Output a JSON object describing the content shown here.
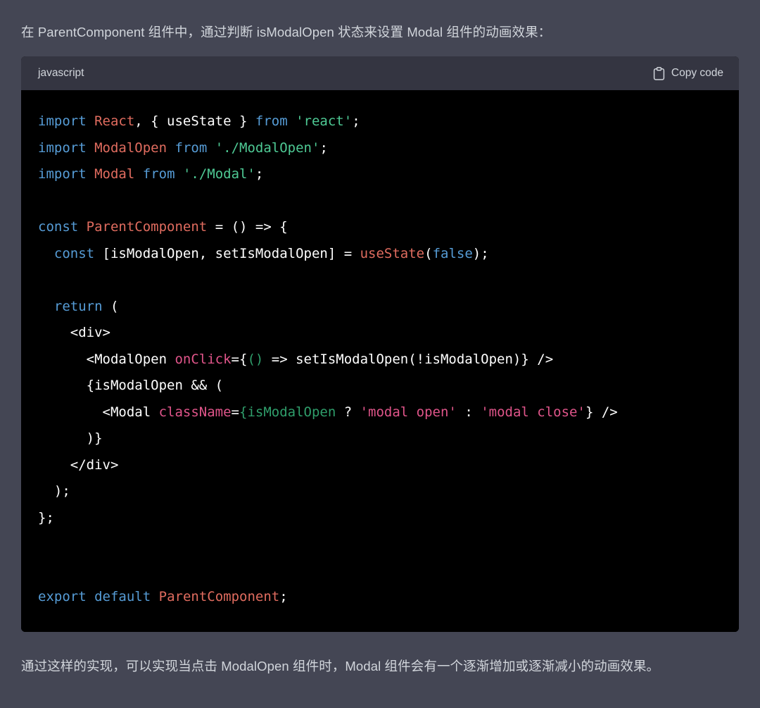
{
  "intro": {
    "text": "在 ParentComponent 组件中，通过判断 isModalOpen 状态来设置 Modal 组件的动画效果："
  },
  "outro": {
    "text": "通过这样的实现，可以实现当点击 ModalOpen 组件时，Modal 组件会有一个逐渐增加或逐渐减小的动画效果。"
  },
  "code_block": {
    "language_label": "javascript",
    "copy_label": "Copy code",
    "copy_icon": "clipboard-icon",
    "colors": {
      "page_background": "#444654",
      "header_background": "#343541",
      "body_background": "#000000",
      "keyword": "#569cd6",
      "identifier": "#e06c5f",
      "string": "#4ec994",
      "attribute": "#e0558a",
      "jsx_expression": "#2f9e6b",
      "plain": "#ffffff",
      "text": "#d1d5db"
    },
    "lines": [
      {
        "id": 1,
        "tokens": [
          {
            "t": "import",
            "c": "kw"
          },
          {
            "t": " ",
            "c": "plain"
          },
          {
            "t": "React",
            "c": "id"
          },
          {
            "t": ", { useState } ",
            "c": "plain"
          },
          {
            "t": "from",
            "c": "kw"
          },
          {
            "t": " ",
            "c": "plain"
          },
          {
            "t": "'react'",
            "c": "str"
          },
          {
            "t": ";",
            "c": "plain"
          }
        ]
      },
      {
        "id": 2,
        "tokens": [
          {
            "t": "import",
            "c": "kw"
          },
          {
            "t": " ",
            "c": "plain"
          },
          {
            "t": "ModalOpen",
            "c": "id"
          },
          {
            "t": " ",
            "c": "plain"
          },
          {
            "t": "from",
            "c": "kw"
          },
          {
            "t": " ",
            "c": "plain"
          },
          {
            "t": "'./ModalOpen'",
            "c": "str"
          },
          {
            "t": ";",
            "c": "plain"
          }
        ]
      },
      {
        "id": 3,
        "tokens": [
          {
            "t": "import",
            "c": "kw"
          },
          {
            "t": " ",
            "c": "plain"
          },
          {
            "t": "Modal",
            "c": "id"
          },
          {
            "t": " ",
            "c": "plain"
          },
          {
            "t": "from",
            "c": "kw"
          },
          {
            "t": " ",
            "c": "plain"
          },
          {
            "t": "'./Modal'",
            "c": "str"
          },
          {
            "t": ";",
            "c": "plain"
          }
        ]
      },
      {
        "id": 4,
        "tokens": [
          {
            "t": "",
            "c": "plain"
          }
        ]
      },
      {
        "id": 5,
        "tokens": [
          {
            "t": "const",
            "c": "kw"
          },
          {
            "t": " ",
            "c": "plain"
          },
          {
            "t": "ParentComponent",
            "c": "id"
          },
          {
            "t": " = () => {",
            "c": "plain"
          }
        ]
      },
      {
        "id": 6,
        "tokens": [
          {
            "t": "  ",
            "c": "plain"
          },
          {
            "t": "const",
            "c": "kw"
          },
          {
            "t": " [isModalOpen, setIsModalOpen] = ",
            "c": "plain"
          },
          {
            "t": "useState",
            "c": "id"
          },
          {
            "t": "(",
            "c": "plain"
          },
          {
            "t": "false",
            "c": "bool"
          },
          {
            "t": ");",
            "c": "plain"
          }
        ]
      },
      {
        "id": 7,
        "tokens": [
          {
            "t": "",
            "c": "plain"
          }
        ]
      },
      {
        "id": 8,
        "tokens": [
          {
            "t": "  ",
            "c": "plain"
          },
          {
            "t": "return",
            "c": "kw"
          },
          {
            "t": " (",
            "c": "plain"
          }
        ]
      },
      {
        "id": 9,
        "tokens": [
          {
            "t": "    <div>",
            "c": "plain"
          }
        ]
      },
      {
        "id": 10,
        "tokens": [
          {
            "t": "      <ModalOpen ",
            "c": "plain"
          },
          {
            "t": "onClick",
            "c": "attr"
          },
          {
            "t": "={",
            "c": "plain"
          },
          {
            "t": "()",
            "c": "grn"
          },
          {
            "t": " => setIsModalOpen(!isModalOpen)} />",
            "c": "plain"
          }
        ]
      },
      {
        "id": 11,
        "tokens": [
          {
            "t": "      {isModalOpen && (",
            "c": "plain"
          }
        ]
      },
      {
        "id": 12,
        "tokens": [
          {
            "t": "        <Modal ",
            "c": "plain"
          },
          {
            "t": "className",
            "c": "attr"
          },
          {
            "t": "=",
            "c": "plain"
          },
          {
            "t": "{isModalOpen",
            "c": "grn"
          },
          {
            "t": " ? ",
            "c": "plain"
          },
          {
            "t": "'modal open'",
            "c": "pink"
          },
          {
            "t": " : ",
            "c": "plain"
          },
          {
            "t": "'modal close'",
            "c": "pink"
          },
          {
            "t": "} />",
            "c": "plain"
          }
        ]
      },
      {
        "id": 13,
        "tokens": [
          {
            "t": "      )}",
            "c": "plain"
          }
        ]
      },
      {
        "id": 14,
        "tokens": [
          {
            "t": "    </div>",
            "c": "plain"
          }
        ]
      },
      {
        "id": 15,
        "tokens": [
          {
            "t": "  );",
            "c": "plain"
          }
        ]
      },
      {
        "id": 16,
        "tokens": [
          {
            "t": "};",
            "c": "plain"
          }
        ]
      },
      {
        "id": 17,
        "tokens": [
          {
            "t": "",
            "c": "plain"
          }
        ]
      },
      {
        "id": 18,
        "tokens": [
          {
            "t": "",
            "c": "plain"
          }
        ]
      },
      {
        "id": 19,
        "tokens": [
          {
            "t": "export",
            "c": "kw"
          },
          {
            "t": " ",
            "c": "plain"
          },
          {
            "t": "default",
            "c": "kw"
          },
          {
            "t": " ",
            "c": "plain"
          },
          {
            "t": "ParentComponent",
            "c": "id"
          },
          {
            "t": ";",
            "c": "plain"
          }
        ]
      }
    ]
  }
}
